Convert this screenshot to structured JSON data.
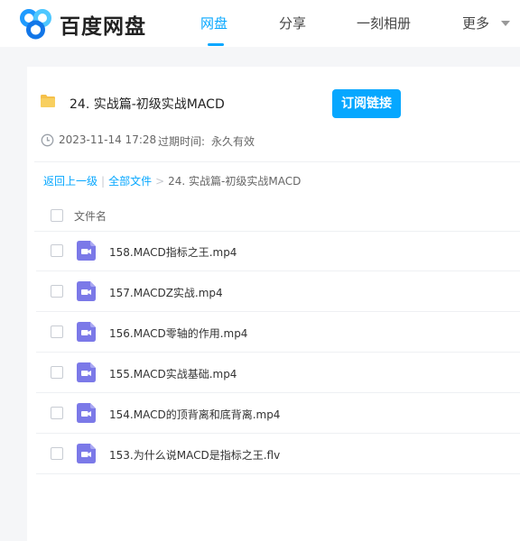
{
  "header": {
    "brand": "百度网盘",
    "nav": [
      {
        "label": "网盘",
        "active": true
      },
      {
        "label": "分享",
        "active": false
      },
      {
        "label": "一刻相册",
        "active": false
      },
      {
        "label": "更多",
        "active": false
      }
    ]
  },
  "share": {
    "title": "24. 实战篇-初级实战MACD",
    "subscribe_label": "订阅链接",
    "date": "2023-11-14 17:28",
    "expire_label": "过期时间:",
    "expire_value": "永久有效"
  },
  "breadcrumb": {
    "back": "返回上一级",
    "separator": "|",
    "all_files": "全部文件",
    "arrow": ">",
    "current": "24. 实战篇-初级实战MACD"
  },
  "file_list": {
    "column_name": "文件名",
    "files": [
      {
        "name": "158.MACD指标之王.mp4"
      },
      {
        "name": "157.MACDZ实战.mp4"
      },
      {
        "name": "156.MACD零轴的作用.mp4"
      },
      {
        "name": "155.MACD实战基础.mp4"
      },
      {
        "name": "154.MACD的顶背离和底背离.mp4"
      },
      {
        "name": "153.为什么说MACD是指标之王.flv"
      }
    ]
  },
  "colors": {
    "accent": "#06a7ff",
    "video_icon": "#7b79e8",
    "folder": "#f5c04a",
    "logo_blue": "#1f9bff",
    "logo_sky": "#4ec7ff"
  },
  "icons": [
    "baidu-netdisk-logo-icon",
    "folder-icon",
    "clock-icon",
    "video-file-icon",
    "caret-down-icon"
  ]
}
